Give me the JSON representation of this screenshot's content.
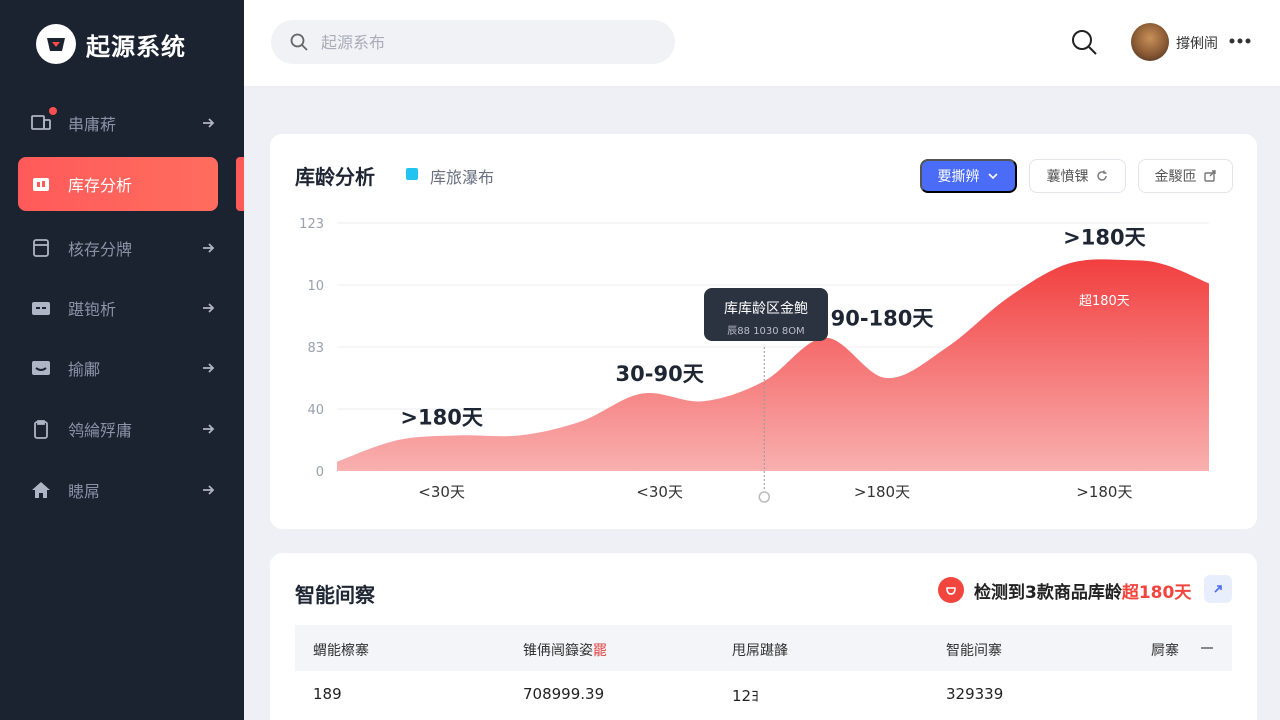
{
  "app": {
    "name": "起源系统"
  },
  "sidebar": {
    "items": [
      {
        "label": "串庸菥",
        "icon": "devices-icon",
        "active": false
      },
      {
        "label": "库存分析",
        "icon": "inventory-icon",
        "active": true
      },
      {
        "label": "核存分牌",
        "icon": "box-icon",
        "active": false
      },
      {
        "label": "踸铇析",
        "icon": "card-icon",
        "active": false
      },
      {
        "label": "揄鄘",
        "icon": "inbox-icon",
        "active": false
      },
      {
        "label": "鸰綸殍庸",
        "icon": "clipboard-icon",
        "active": false
      },
      {
        "label": "瞣屌",
        "icon": "home-icon",
        "active": false
      }
    ]
  },
  "header": {
    "search_placeholder": "起源系布",
    "user_name": "撐俐闹"
  },
  "chart_card": {
    "title": "库龄分析",
    "legend_label": "库旅瀑布",
    "buttons": {
      "primary": "要撕辨",
      "secondary": "蘘憤锞",
      "tertiary": "金騣匝"
    },
    "tooltip": {
      "title": "库库龄区金鲍",
      "subtitle": "辰88 1030 8OM"
    }
  },
  "chart_data": {
    "type": "area",
    "title": "库龄分析",
    "y_tick_labels": [
      "0",
      "40",
      "83",
      "10",
      "123"
    ],
    "y_tick_values": [
      0,
      40,
      80,
      120,
      160
    ],
    "x_tick_labels": [
      "<30天",
      "<30天",
      ">180天",
      ">180天"
    ],
    "x_tick_positions": [
      0.12,
      0.37,
      0.625,
      0.88
    ],
    "ylim": [
      0,
      160
    ],
    "series": [
      {
        "name": "库旅瀑布",
        "x": [
          0,
          0.07,
          0.14,
          0.21,
          0.28,
          0.35,
          0.42,
          0.49,
          0.56,
          0.63,
          0.7,
          0.77,
          0.84,
          0.91,
          0.95,
          1.0
        ],
        "values": [
          6,
          20,
          23,
          23,
          32,
          50,
          45,
          58,
          86,
          60,
          80,
          112,
          134,
          136,
          133,
          121
        ]
      }
    ],
    "annotations": [
      {
        "text": ">180天",
        "x": 0.12,
        "y": 30
      },
      {
        "text": "30-90天",
        "x": 0.37,
        "y": 58
      },
      {
        "text": "90-180天",
        "x": 0.625,
        "y": 94
      },
      {
        "text": ">180天",
        "x": 0.88,
        "y": 146
      },
      {
        "text": "超180天",
        "x": 0.88,
        "y": 107
      }
    ],
    "grid": true,
    "legend": "top-left",
    "fill_color_top": "#f23f3f",
    "fill_color_bottom": "#f9b0b0"
  },
  "insight_card": {
    "title": "智能间察",
    "alert_prefix": "检测到3款商品库龄",
    "alert_highlight": "超180天",
    "table": {
      "headers": [
        "蝟能檫寨",
        "锥侢闿籙姿",
        "罷",
        "甩屌踸韸",
        "智能间寨",
        "屙寨"
      ],
      "row": [
        "189",
        "708999.39",
        "12ﾖ",
        "329339"
      ]
    }
  },
  "colors": {
    "sidebar_bg": "#1b2230",
    "accent_red": "#ff5a5a",
    "primary_blue": "#4a6cf7",
    "legend_cyan": "#22c3f0"
  }
}
